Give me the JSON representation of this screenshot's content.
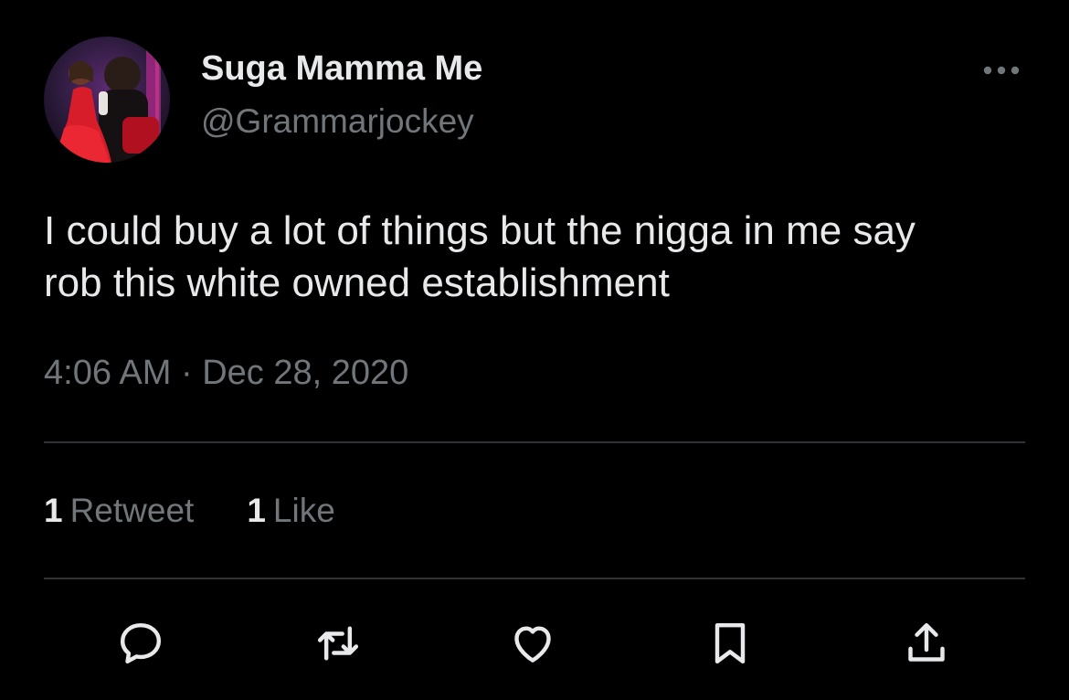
{
  "author": {
    "display_name": "Suga Mamma Me",
    "handle": "@Grammarjockey",
    "avatar_icon": "profile-photo-avatar"
  },
  "tweet": {
    "text_lines": [
      "I could buy a lot of things but the nigga in me say",
      "rob this white owned establishment"
    ],
    "timestamp": "4:06 AM · Dec 28, 2020"
  },
  "stats": {
    "retweets": {
      "count": "1",
      "label": "Retweet"
    },
    "likes": {
      "count": "1",
      "label": "Like"
    }
  },
  "actions": [
    {
      "icon": "reply-icon"
    },
    {
      "icon": "retweet-icon"
    },
    {
      "icon": "like-icon"
    },
    {
      "icon": "bookmark-icon"
    },
    {
      "icon": "share-icon"
    }
  ],
  "colors": {
    "background": "#000000",
    "primary_text": "#e7e9ea",
    "secondary_text": "#71767b",
    "divider": "#2f3336"
  }
}
